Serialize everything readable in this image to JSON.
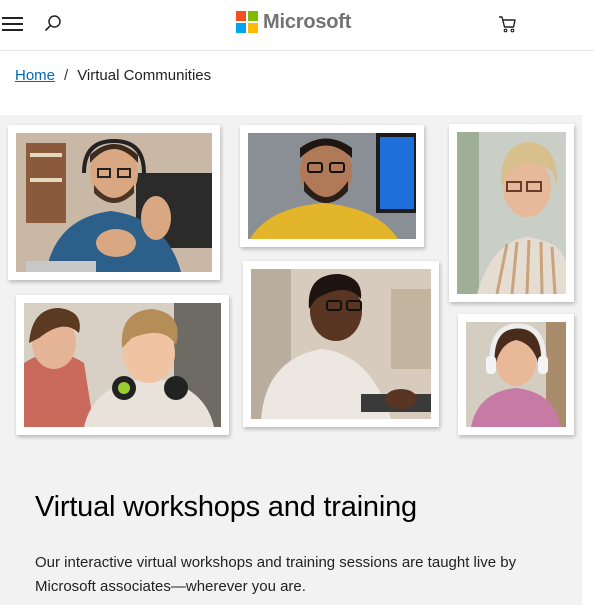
{
  "header": {
    "menu_icon": "hamburger-menu-icon",
    "search_icon": "search-icon",
    "logo_text": "Microsoft",
    "logo_colors": [
      "#f25022",
      "#7fba00",
      "#00a4ef",
      "#ffb900"
    ],
    "cart_icon": "shopping-cart-icon"
  },
  "breadcrumb": {
    "home": "Home",
    "separator": "/",
    "current": "Virtual Communities"
  },
  "hero": {
    "photos": [
      {
        "name": "photo-man-headset-gesturing"
      },
      {
        "name": "photo-man-glasses-yellow-shirt"
      },
      {
        "name": "photo-woman-glasses-striped-shirt"
      },
      {
        "name": "photo-teens-laughing-headphones"
      },
      {
        "name": "photo-woman-laptop-smiling"
      },
      {
        "name": "photo-girl-headphones-writing"
      }
    ],
    "title": "Virtual workshops and training",
    "description": "Our interactive virtual workshops and training sessions are taught live by Microsoft associates—wherever you are."
  },
  "colors": {
    "link": "#0067b8",
    "hero_background": "#f2f2f2"
  }
}
